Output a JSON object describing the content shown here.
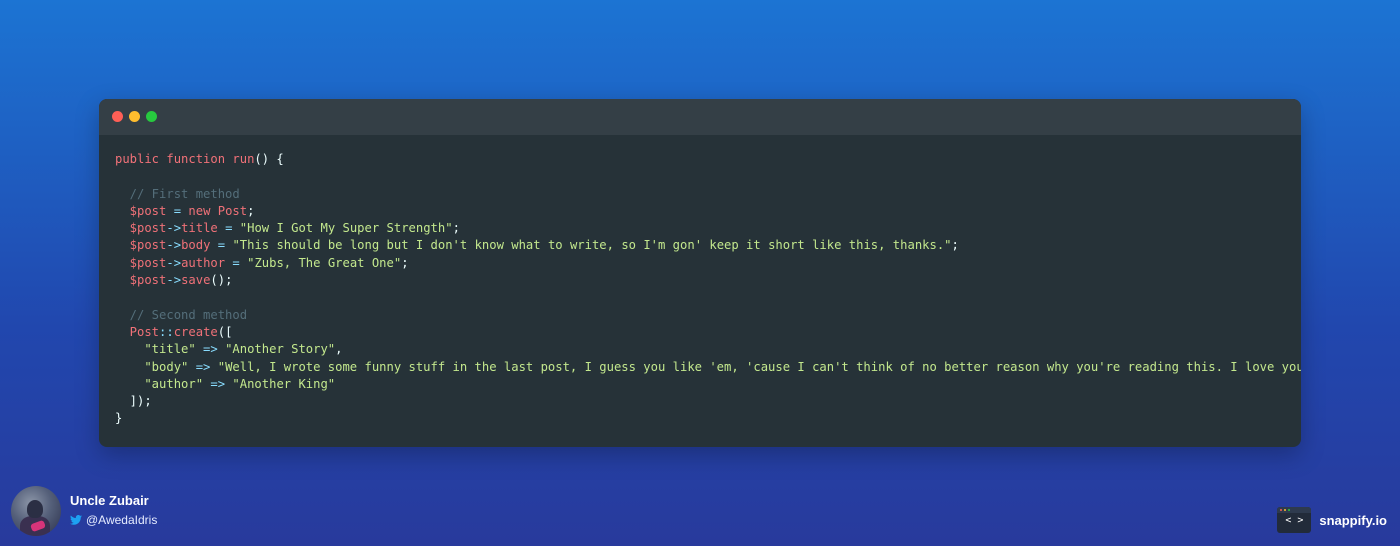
{
  "window": {
    "controls": [
      "close",
      "minimize",
      "maximize"
    ]
  },
  "code": {
    "lines": [
      [
        [
          "kw",
          "public function "
        ],
        [
          "fn",
          "run"
        ],
        [
          "pn",
          "() {"
        ]
      ],
      [],
      [
        [
          "cm",
          "  // First method"
        ]
      ],
      [
        [
          "var",
          "  $post"
        ],
        [
          "op",
          " = "
        ],
        [
          "kw",
          "new "
        ],
        [
          "fn",
          "Post"
        ],
        [
          "pn",
          ";"
        ]
      ],
      [
        [
          "var",
          "  $post"
        ],
        [
          "op",
          "->"
        ],
        [
          "prop",
          "title"
        ],
        [
          "op",
          " = "
        ],
        [
          "str",
          "\"How I Got My Super Strength\""
        ],
        [
          "pn",
          ";"
        ]
      ],
      [
        [
          "var",
          "  $post"
        ],
        [
          "op",
          "->"
        ],
        [
          "prop",
          "body"
        ],
        [
          "op",
          " = "
        ],
        [
          "str",
          "\"This should be long but I don't know what to write, so I'm gon' keep it short like this, thanks.\""
        ],
        [
          "pn",
          ";"
        ]
      ],
      [
        [
          "var",
          "  $post"
        ],
        [
          "op",
          "->"
        ],
        [
          "prop",
          "author"
        ],
        [
          "op",
          " = "
        ],
        [
          "str",
          "\"Zubs, The Great One\""
        ],
        [
          "pn",
          ";"
        ]
      ],
      [
        [
          "var",
          "  $post"
        ],
        [
          "op",
          "->"
        ],
        [
          "fn",
          "save"
        ],
        [
          "pn",
          "();"
        ]
      ],
      [],
      [
        [
          "cm",
          "  // Second method"
        ]
      ],
      [
        [
          "fn",
          "  Post"
        ],
        [
          "op",
          "::"
        ],
        [
          "fn",
          "create"
        ],
        [
          "pn",
          "(["
        ]
      ],
      [
        [
          "str",
          "    \"title\""
        ],
        [
          "op",
          " => "
        ],
        [
          "str",
          "\"Another Story\""
        ],
        [
          "pn",
          ","
        ]
      ],
      [
        [
          "str",
          "    \"body\""
        ],
        [
          "op",
          " => "
        ],
        [
          "str",
          "\"Well, I wrote some funny stuff in the last post, I guess you like 'em, 'cause I can't think of no better reason why you're reading this. I love you, bro\""
        ],
        [
          "pn",
          ","
        ]
      ],
      [
        [
          "str",
          "    \"author\""
        ],
        [
          "op",
          " => "
        ],
        [
          "str",
          "\"Another King\""
        ]
      ],
      [
        [
          "pn",
          "  ]);"
        ]
      ],
      [
        [
          "pn",
          "}"
        ]
      ]
    ]
  },
  "author": {
    "name": "Uncle Zubair",
    "handle": "@AwedaIdris",
    "twitter_icon": "twitter-bird-icon"
  },
  "brand": {
    "logo_glyph": "< >",
    "name": "snappify.io"
  },
  "colors": {
    "keyword": "#f07178",
    "string": "#c3e88d",
    "operator": "#89ddff",
    "comment": "#546e7a",
    "editor_bg": "#263238",
    "twitter": "#1da1f2"
  }
}
